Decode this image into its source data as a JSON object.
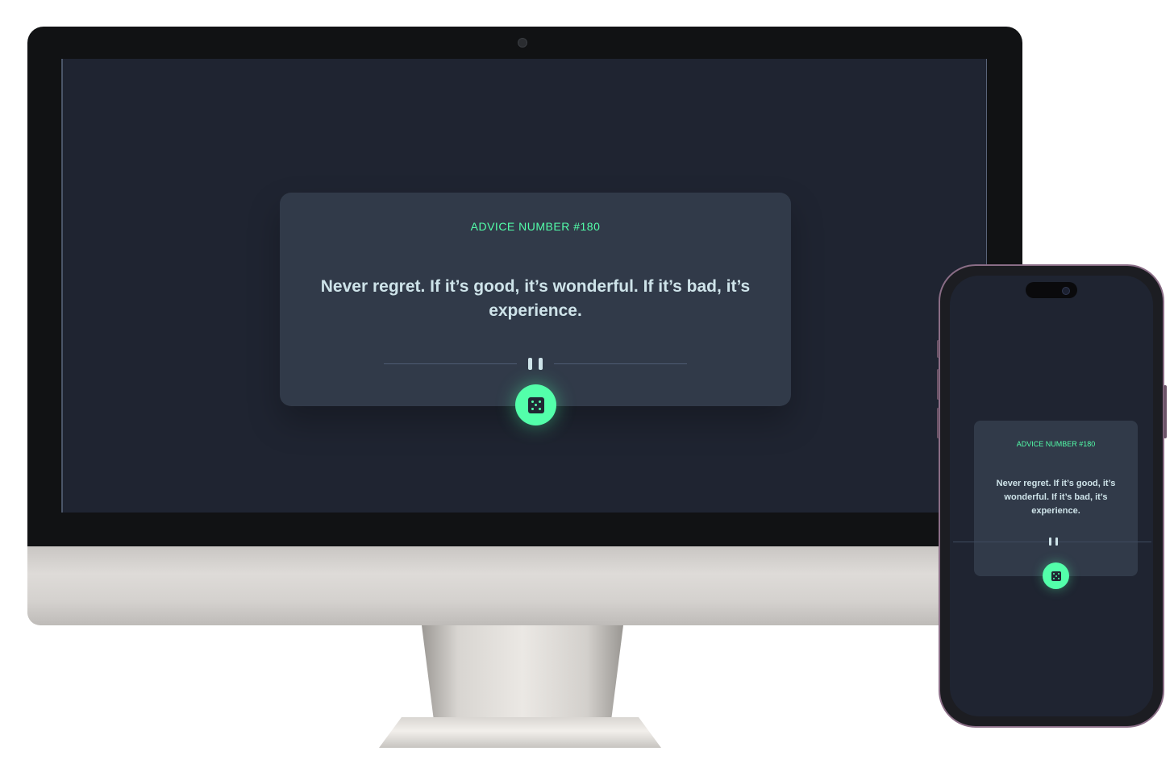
{
  "desktop": {
    "card": {
      "label": "ADVICE NUMBER #180",
      "quote": "Never regret. If it’s good, it’s wonderful. If it’s bad, it’s experience."
    }
  },
  "mobile": {
    "card": {
      "label": "ADVICE NUMBER #180",
      "quote": "Never regret. If it’s good, it’s wonderful. If it’s bad, it’s experience."
    }
  },
  "icons": {
    "pause": "pause-divider-icon",
    "dice": "dice-icon",
    "webcam": "webcam-icon"
  },
  "colors": {
    "accent": "#53ffaa",
    "card_background": "#313a49",
    "page_background": "#1f2431",
    "text": "#cee3e9"
  }
}
